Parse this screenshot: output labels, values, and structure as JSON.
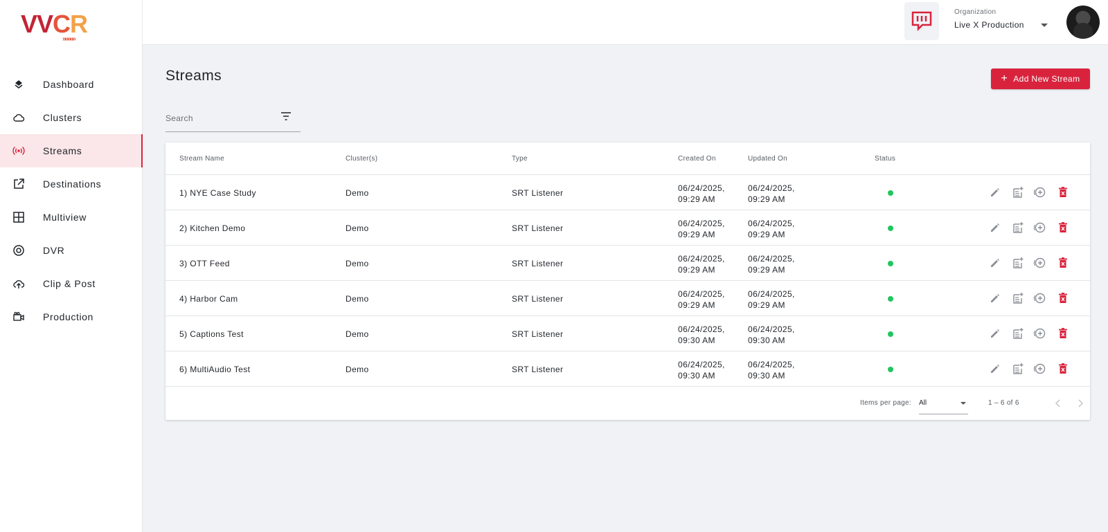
{
  "brand": {
    "logo_text_v": "VV",
    "logo_text_c": "C",
    "logo_text_r": "R",
    "logo_chevrons": "»»»»»",
    "accent": "#d9233d"
  },
  "sidebar": {
    "items": [
      {
        "label": "Dashboard",
        "icon": "layers-icon"
      },
      {
        "label": "Clusters",
        "icon": "cloud-icon"
      },
      {
        "label": "Streams",
        "icon": "broadcast-icon",
        "active": true
      },
      {
        "label": "Destinations",
        "icon": "external-link-icon"
      },
      {
        "label": "Multiview",
        "icon": "grid-icon"
      },
      {
        "label": "DVR",
        "icon": "record-icon"
      },
      {
        "label": "Clip & Post",
        "icon": "cloud-upload-icon"
      },
      {
        "label": "Production",
        "icon": "video-camera-icon"
      }
    ]
  },
  "header": {
    "org_label": "Organization",
    "org_value": "Live X Production"
  },
  "main": {
    "title": "Streams",
    "add_button": "Add New Stream",
    "search_placeholder": "Search"
  },
  "table": {
    "columns": [
      "Stream Name",
      "Cluster(s)",
      "Type",
      "Created On",
      "Updated On",
      "Status"
    ],
    "rows": [
      {
        "name": "1) NYE Case Study",
        "cluster": "Demo",
        "type": "SRT Listener",
        "created_1": "06/24/2025,",
        "created_2": "09:29 AM",
        "updated_1": "06/24/2025,",
        "updated_2": "09:29 AM",
        "status": "active"
      },
      {
        "name": "2) Kitchen Demo",
        "cluster": "Demo",
        "type": "SRT Listener",
        "created_1": "06/24/2025,",
        "created_2": "09:29 AM",
        "updated_1": "06/24/2025,",
        "updated_2": "09:29 AM",
        "status": "active"
      },
      {
        "name": "3) OTT Feed",
        "cluster": "Demo",
        "type": "SRT Listener",
        "created_1": "06/24/2025,",
        "created_2": "09:29 AM",
        "updated_1": "06/24/2025,",
        "updated_2": "09:29 AM",
        "status": "active"
      },
      {
        "name": "4) Harbor Cam",
        "cluster": "Demo",
        "type": "SRT Listener",
        "created_1": "06/24/2025,",
        "created_2": "09:29 AM",
        "updated_1": "06/24/2025,",
        "updated_2": "09:29 AM",
        "status": "active"
      },
      {
        "name": "5) Captions Test",
        "cluster": "Demo",
        "type": "SRT Listener",
        "created_1": "06/24/2025,",
        "created_2": "09:30 AM",
        "updated_1": "06/24/2025,",
        "updated_2": "09:30 AM",
        "status": "active"
      },
      {
        "name": "6) MultiAudio Test",
        "cluster": "Demo",
        "type": "SRT Listener",
        "created_1": "06/24/2025,",
        "created_2": "09:30 AM",
        "updated_1": "06/24/2025,",
        "updated_2": "09:30 AM",
        "status": "active"
      }
    ],
    "row_actions": [
      "edit-icon",
      "add-note-icon",
      "add-circle-icon",
      "delete-icon"
    ],
    "status_color": "#22c55e"
  },
  "paginator": {
    "items_per_page_label": "Items per page:",
    "items_per_page_value": "All",
    "range_label": "1 – 6 of 6"
  }
}
